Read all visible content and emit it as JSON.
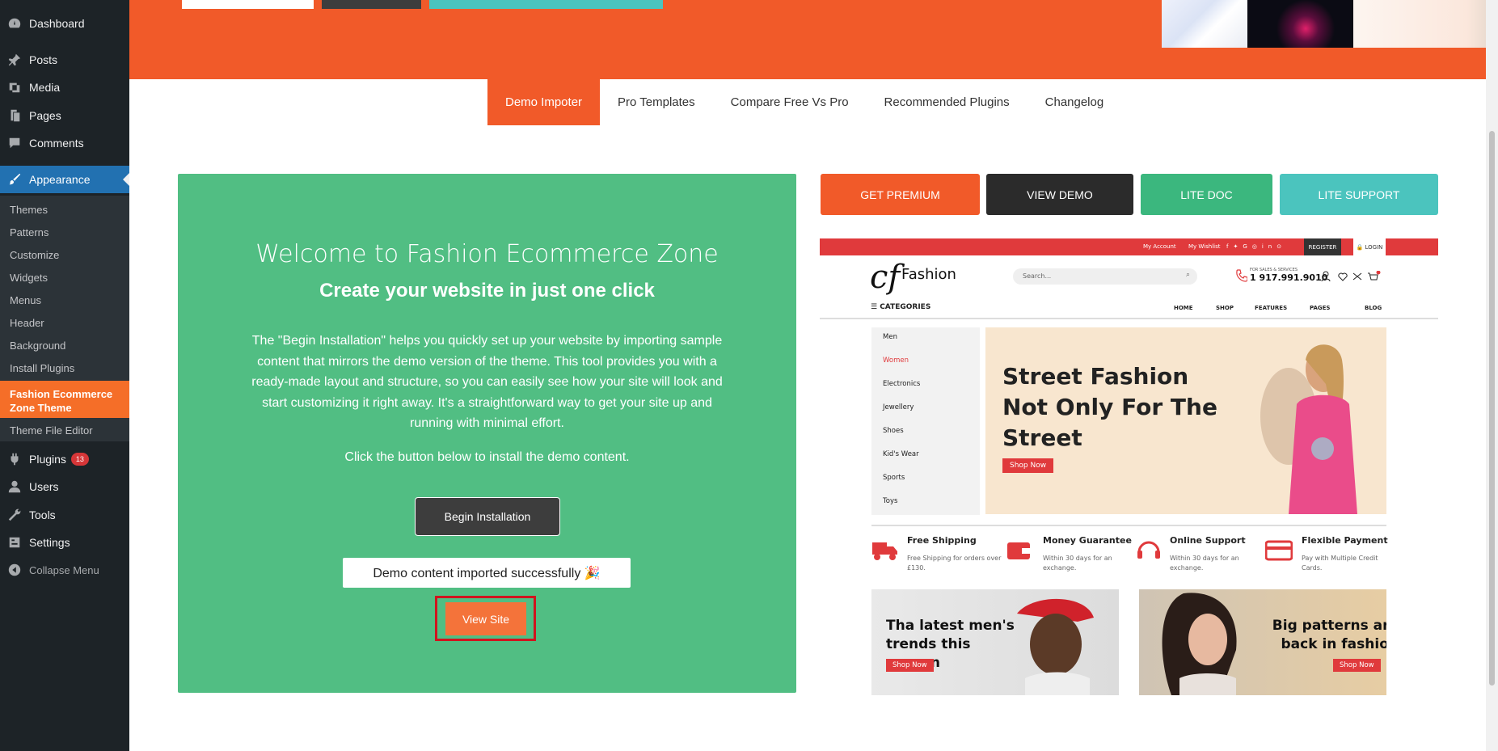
{
  "sidebar": {
    "menu": [
      {
        "label": "Dashboard",
        "icon": "dashboard-icon"
      },
      {
        "label": "Posts",
        "icon": "pin-icon"
      },
      {
        "label": "Media",
        "icon": "media-icon"
      },
      {
        "label": "Pages",
        "icon": "pages-icon"
      },
      {
        "label": "Comments",
        "icon": "comment-icon"
      },
      {
        "label": "Appearance",
        "icon": "brush-icon"
      },
      {
        "label": "Plugins",
        "icon": "plugin-icon",
        "badge": "13"
      },
      {
        "label": "Users",
        "icon": "user-icon"
      },
      {
        "label": "Tools",
        "icon": "wrench-icon"
      },
      {
        "label": "Settings",
        "icon": "settings-icon"
      }
    ],
    "submenu": [
      "Themes",
      "Patterns",
      "Customize",
      "Widgets",
      "Menus",
      "Header",
      "Background",
      "Install Plugins"
    ],
    "current_sub": "Fashion Ecommerce Zone Theme",
    "editor": "Theme File Editor",
    "collapse": "Collapse Menu"
  },
  "tabs": [
    "Demo Impoter",
    "Pro Templates",
    "Compare Free Vs Pro",
    "Recommended Plugins",
    "Changelog"
  ],
  "panel": {
    "welcome": "Welcome to Fashion Ecommerce Zone",
    "headline": "Create your website in just one click",
    "paragraph": "The \"Begin Installation\" helps you quickly set up your website by importing sample content that mirrors the demo version of the theme. This tool provides you with a ready-made layout and structure, so you can easily see how your site will look and start customizing it right away. It's a straightforward way to get your site up and running with minimal effort.",
    "click_note": "Click the button below to install the demo content.",
    "begin_button": "Begin Installation",
    "success": "Demo content imported successfully 🎉",
    "view_site": "View Site"
  },
  "actions": {
    "premium": "GET PREMIUM",
    "demo": "VIEW DEMO",
    "doc": "LITE DOC",
    "support": "LITE SUPPORT"
  },
  "preview": {
    "top_links": [
      "My Account",
      "My Wishlist"
    ],
    "register": "REGISTER",
    "login": "🔒 LOGIN",
    "logo_mark": "cf",
    "logo": "Fashion",
    "search_placeholder": "Search...",
    "phone_label": "FOR SALES & SERVICES",
    "phone": "1 917.991.9010",
    "categories_label": "☰ CATEGORIES",
    "nav": [
      "HOME",
      "SHOP",
      "FEATURES",
      "PAGES",
      "BLOG"
    ],
    "categories": [
      "Men",
      "Women",
      "Electronics",
      "Jewellery",
      "Shoes",
      "Kid's Wear",
      "Sports",
      "Toys"
    ],
    "hero_title": "Street Fashion Not Only For The Street",
    "hero_button": "Shop Now",
    "features": [
      {
        "title": "Free Shipping",
        "desc": "Free Shipping for orders over £130."
      },
      {
        "title": "Money Guarantee",
        "desc": "Within 30 days for an exchange."
      },
      {
        "title": "Online Support",
        "desc": "Within 30 days for an exchange."
      },
      {
        "title": "Flexible Payment",
        "desc": "Pay with Multiple Credit Cards."
      }
    ],
    "promos": [
      {
        "text": "Tha latest men's trends this season",
        "button": "Shop Now"
      },
      {
        "text": "Big patterns are back in fashion",
        "button": "Shop Now"
      }
    ]
  },
  "colors": {
    "brand_orange": "#f15a29",
    "panel_green": "#51be83",
    "sidebar_bg": "#1d2327",
    "active_blue": "#2271b1",
    "preview_red": "#e03a3c"
  }
}
